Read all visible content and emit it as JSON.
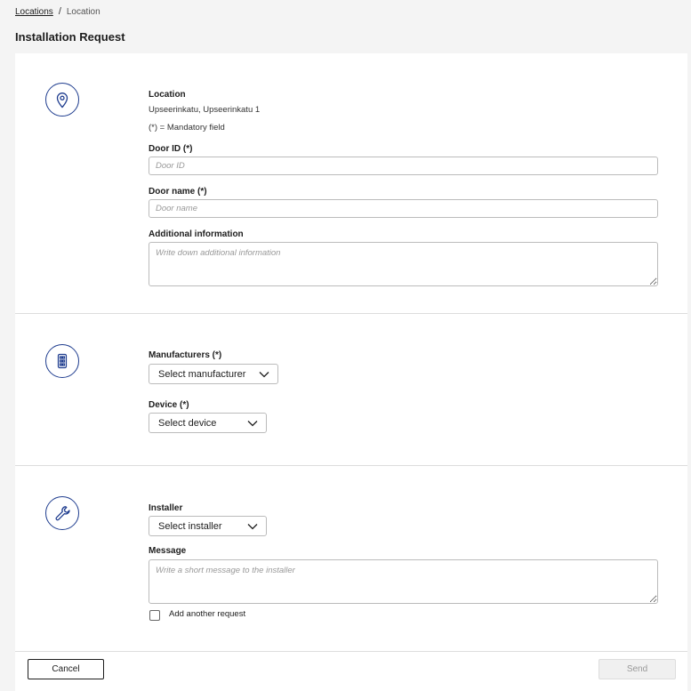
{
  "breadcrumb": {
    "parent": "Locations",
    "separator": "/",
    "current": "Location"
  },
  "page_title": "Installation Request",
  "location_section": {
    "location_label": "Location",
    "location_value": "Upseerinkatu, Upseerinkatu 1",
    "mandatory_note": "(*) = Mandatory field",
    "door_id_label": "Door ID (*)",
    "door_id_placeholder": "Door ID",
    "door_id_value": "",
    "door_name_label": "Door name (*)",
    "door_name_placeholder": "Door name",
    "door_name_value": "",
    "additional_label": "Additional information",
    "additional_placeholder": "Write down additional information",
    "icon": "location-pin-icon"
  },
  "device_section": {
    "manufacturers_label": "Manufacturers (*)",
    "manufacturer_selected": "Select manufacturer",
    "device_label": "Device (*)",
    "device_selected": "Select device",
    "icon": "keypad-icon"
  },
  "installer_section": {
    "installer_label": "Installer",
    "installer_selected": "Select installer",
    "message_label": "Message",
    "message_placeholder": "Write a short message to the installer",
    "add_another_label": "Add another request",
    "add_another_checked": false,
    "icon": "wrench-icon"
  },
  "footer": {
    "cancel_label": "Cancel",
    "send_label": "Send"
  },
  "colors": {
    "accent": "#1f3d8f",
    "background": "#f4f4f4",
    "card": "#ffffff"
  }
}
